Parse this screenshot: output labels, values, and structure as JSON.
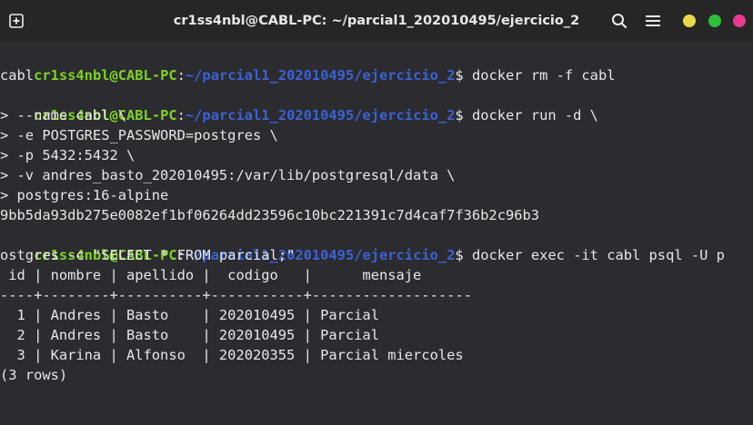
{
  "window": {
    "title": "cr1ss4nbl@CABL-PC: ~/parcial1_202010495/ejercicio_2",
    "buttons": {
      "new_tab_icon": "new-tab-icon",
      "search_icon": "search-icon",
      "menu_icon": "hamburger-menu-icon",
      "minimize_color": "#e6d94a",
      "maximize_color": "#2ebd3e",
      "close_color": "#e83a8e"
    }
  },
  "prompt": {
    "user": "cr1ss4nbl@CABL-PC",
    "colon": ":",
    "path": "~/parcial1_202010495/ejercicio_2",
    "dollar": "$"
  },
  "terminal": {
    "cmd1": " docker rm -f cabl",
    "out1": "cabl",
    "cmd2": " docker run -d \\",
    "cont1": "> --name cabl \\",
    "cont2": "> -e POSTGRES_PASSWORD=postgres \\",
    "cont3": "> -p 5432:5432 \\",
    "cont4": "> -v andres_basto_202010495:/var/lib/postgresql/data \\",
    "cont5": "> postgres:16-alpine",
    "container_id": "9bb5da93db275e0082ef1bf06264dd23596c10bc221391c7d4caf7f36b2c96b3",
    "cmd3": " docker exec -it cabl psql -U p",
    "cmd3_wrap": "ostgres -c \"SELECT * FROM parcial;\"",
    "table_header": " id | nombre | apellido |  codigo   |      mensaje",
    "table_sep": "----+--------+----------+-----------+-------------------",
    "rows": [
      "  1 | Andres | Basto    | 202010495 | Parcial",
      "  2 | Andres | Basto    | 202010495 | Parcial",
      "  3 | Karina | Alfonso  | 202020355 | Parcial miercoles"
    ],
    "row_count": "(3 rows)",
    "blank": ""
  },
  "colors": {
    "user": "#7ed321",
    "path": "#3b62d6",
    "text": "#e8e8e8",
    "background": "#2b2b30",
    "titlebar": "#262626"
  }
}
